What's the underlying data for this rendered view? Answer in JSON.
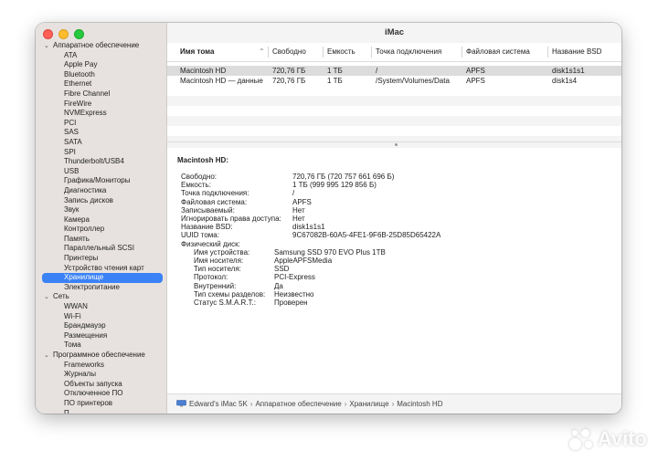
{
  "window": {
    "title": "iMac"
  },
  "sidebar": {
    "sections": [
      {
        "label": "Аппаратное обеспечение",
        "items": [
          "ATA",
          "Apple Pay",
          "Bluetooth",
          "Ethernet",
          "Fibre Channel",
          "FireWire",
          "NVMExpress",
          "PCI",
          "SAS",
          "SATA",
          "SPI",
          "Thunderbolt/USB4",
          "USB",
          "Графика/Мониторы",
          "Диагностика",
          "Запись дисков",
          "Звук",
          "Камера",
          "Контроллер",
          "Память",
          "Параллельный SCSI",
          "Принтеры",
          "Устройство чтения карт",
          "Хранилище",
          "Электропитание"
        ]
      },
      {
        "label": "Сеть",
        "items": [
          "WWAN",
          "Wi-Fi",
          "Брандмауэр",
          "Размещения",
          "Тома"
        ]
      },
      {
        "label": "Программное обеспечение",
        "items": [
          "Frameworks",
          "Журналы",
          "Объекты запуска",
          "Отключенное ПО",
          "ПО принтеров",
          "П..."
        ]
      }
    ],
    "selected_item": "Хранилище"
  },
  "table": {
    "columns": [
      "Имя тома",
      "Свободно",
      "Емкость",
      "Точка подключения",
      "Файловая система",
      "Название BSD"
    ],
    "rows": [
      [
        "Macintosh HD",
        "720,76 ГБ",
        "1 ТБ",
        "/",
        "APFS",
        "disk1s1s1"
      ],
      [
        "Macintosh HD — данные",
        "720,76 ГБ",
        "1 ТБ",
        "/System/Volumes/Data",
        "APFS",
        "disk1s4"
      ]
    ]
  },
  "detail": {
    "heading": "Macintosh HD:",
    "fields": [
      {
        "label": "Свободно:",
        "value": "720,76 ГБ (720 757 661 696 Б)"
      },
      {
        "label": "Емкость:",
        "value": "1 ТБ (999 995 129 856 Б)"
      },
      {
        "label": "Точка подключения:",
        "value": "/"
      },
      {
        "label": "Файловая система:",
        "value": "APFS"
      },
      {
        "label": "Записываемый:",
        "value": "Нет"
      },
      {
        "label": "Игнорировать права доступа:",
        "value": "Нет"
      },
      {
        "label": "Название BSD:",
        "value": "disk1s1s1"
      },
      {
        "label": "UUID тома:",
        "value": "9C67082B-60A5-4FE1-9F6B-25D85D65422A"
      },
      {
        "label": "Физический диск:",
        "value": ""
      }
    ],
    "disk_fields": [
      {
        "label": "Имя устройства:",
        "value": "Samsung SSD 970 EVO Plus 1TB"
      },
      {
        "label": "Имя носителя:",
        "value": "AppleAPFSMedia"
      },
      {
        "label": "Тип носителя:",
        "value": "SSD"
      },
      {
        "label": "Протокол:",
        "value": "PCI-Express"
      },
      {
        "label": "Внутренний:",
        "value": "Да"
      },
      {
        "label": "Тип схемы разделов:",
        "value": "Неизвестно"
      },
      {
        "label": "Статус S.M.A.R.T.:",
        "value": "Проверен"
      }
    ]
  },
  "statusbar": {
    "icon": "monitor-icon",
    "crumbs": [
      "Edward's iMac 5K",
      "Аппаратное обеспечение",
      "Хранилище",
      "Macintosh HD"
    ]
  },
  "watermark": {
    "text": "Avito"
  }
}
